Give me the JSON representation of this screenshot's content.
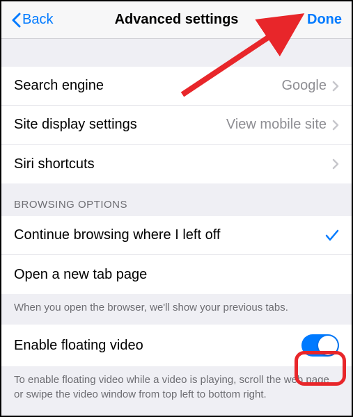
{
  "nav": {
    "back_label": "Back",
    "title": "Advanced settings",
    "done_label": "Done"
  },
  "general": {
    "search_engine_label": "Search engine",
    "search_engine_value": "Google",
    "site_display_label": "Site display settings",
    "site_display_value": "View mobile site",
    "siri_label": "Siri shortcuts"
  },
  "browsing": {
    "section_title": "BROWSING OPTIONS",
    "continue_label": "Continue browsing where I left off",
    "newtab_label": "Open a new tab page",
    "footer": "When you open the browser, we'll show your previous tabs."
  },
  "floating": {
    "label": "Enable floating video",
    "footer": "To enable floating video while a video is playing, scroll the web page or swipe the video window from top left to bottom right."
  },
  "annotation": {
    "highlight_color": "#e8262a"
  }
}
